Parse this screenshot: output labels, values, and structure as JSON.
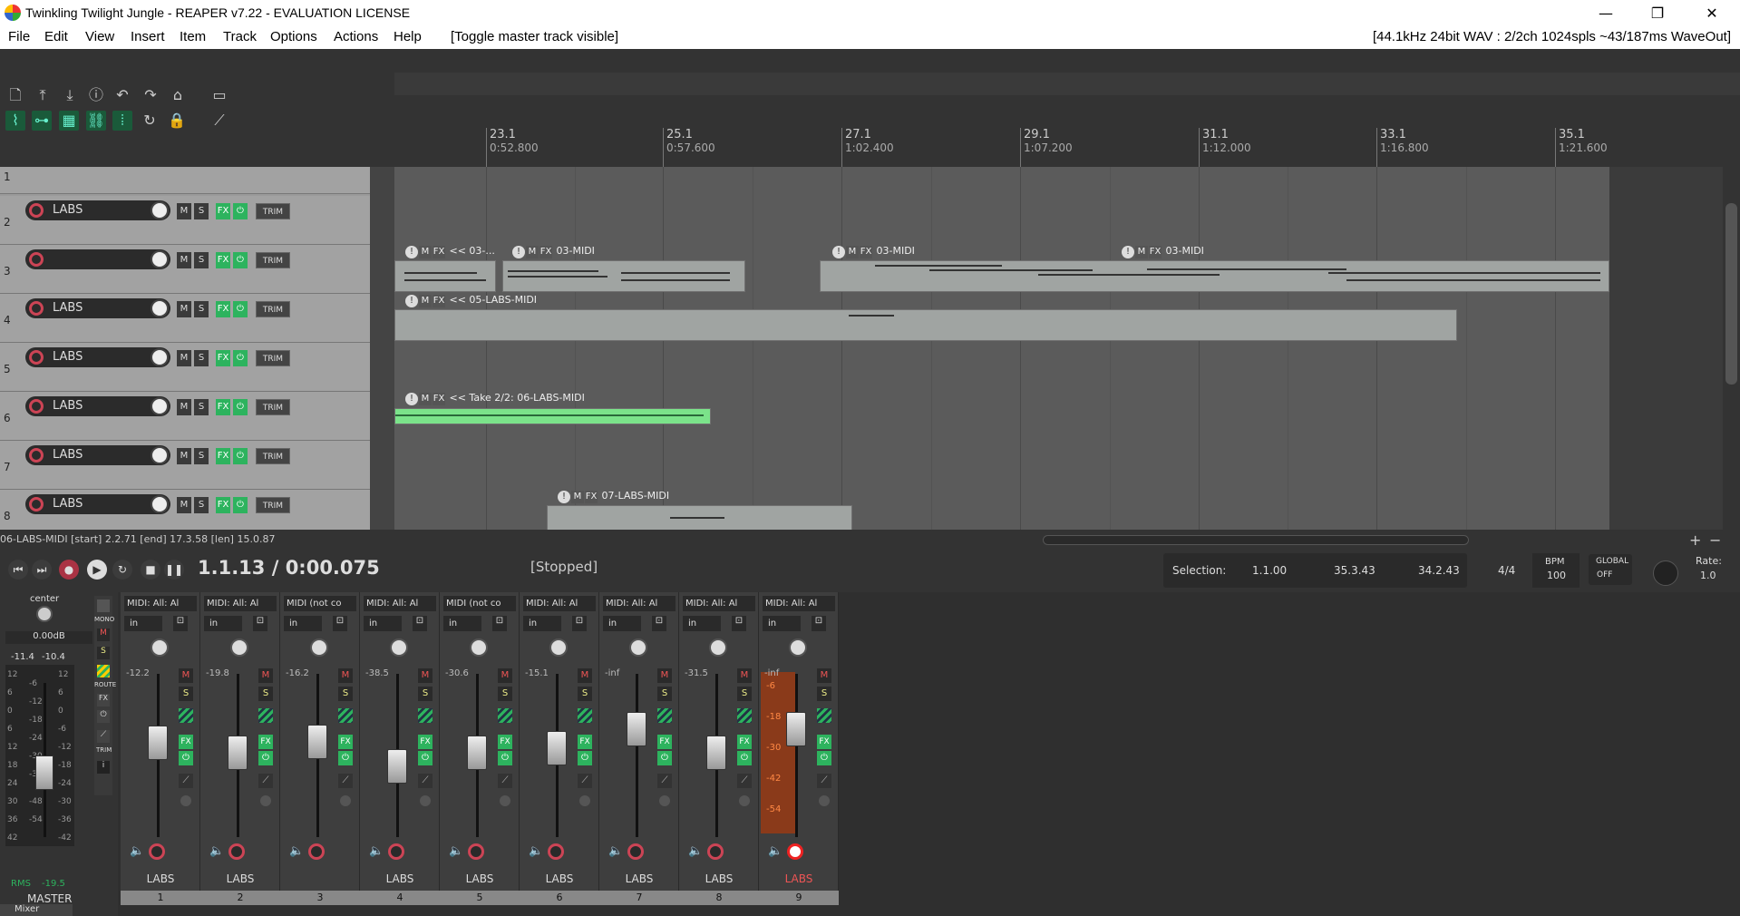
{
  "window": {
    "title": "Twinkling Twilight Jungle - REAPER v7.22 - EVALUATION LICENSE",
    "controls": [
      "—",
      "❐",
      "✕"
    ]
  },
  "menu": {
    "items": [
      "File",
      "Edit",
      "View",
      "Insert",
      "Item",
      "Track",
      "Options",
      "Actions",
      "Help",
      "[Toggle master track visible]"
    ],
    "status": "[44.1kHz 24bit WAV : 2/2ch 1024spls ~43/187ms WaveOut]"
  },
  "ruler": {
    "marks": [
      {
        "bar": "23.1",
        "time": "0:52.800"
      },
      {
        "bar": "25.1",
        "time": "0:57.600"
      },
      {
        "bar": "27.1",
        "time": "1:02.400"
      },
      {
        "bar": "29.1",
        "time": "1:07.200"
      },
      {
        "bar": "31.1",
        "time": "1:12.000"
      },
      {
        "bar": "33.1",
        "time": "1:16.800"
      },
      {
        "bar": "35.1",
        "time": "1:21.600"
      }
    ]
  },
  "tracks": [
    {
      "num": "1",
      "name": ""
    },
    {
      "num": "2",
      "name": "LABS"
    },
    {
      "num": "3",
      "name": ""
    },
    {
      "num": "4",
      "name": "LABS"
    },
    {
      "num": "5",
      "name": "LABS"
    },
    {
      "num": "6",
      "name": "LABS"
    },
    {
      "num": "7",
      "name": "LABS"
    },
    {
      "num": "8",
      "name": "LABS"
    }
  ],
  "track_buttons": {
    "mute": "M",
    "solo": "S",
    "fx": "FX",
    "trim": "TRIM"
  },
  "items": {
    "t3a": "<< 03-...",
    "t3b": "03-MIDI",
    "t3c": "03-MIDI",
    "t3d": "03-MIDI",
    "t4": "<< 05-LABS-MIDI",
    "t6": "<< Take 2/2: 06-LABS-MIDI",
    "t8": "07-LABS-MIDI"
  },
  "item_info": "06-LABS-MIDI [start] 2.2.71 [end] 17.3.58 [len] 15.0.87",
  "transport": {
    "time": "1.1.13 / 0:00.075",
    "state": "[Stopped]",
    "selection_label": "Selection:",
    "sel_start": "1.1.00",
    "sel_end": "35.3.43",
    "sel_len": "34.2.43",
    "timesig": "4/4",
    "bpm_label": "BPM",
    "bpm": "100",
    "global_label": "GLOBAL",
    "global_state": "OFF",
    "rate_label": "Rate:",
    "rate": "1.0"
  },
  "master": {
    "pan_label": "center",
    "vol": "0.00dB",
    "peak_l": "-11.4",
    "peak_r": "-10.4",
    "mono": "MONO",
    "route": "ROUTE",
    "trim": "TRIM",
    "rms_label": "RMS",
    "rms": "-19.5",
    "name": "MASTER",
    "scale_l": [
      "12",
      "6",
      "0",
      "6",
      "12",
      "18",
      "24",
      "30",
      "36",
      "42"
    ],
    "scale_m": [
      "-6",
      "-12",
      "-18",
      "-24",
      "-30",
      "-36",
      "-48",
      "-54"
    ],
    "scale_r": [
      "12",
      "6",
      "0",
      "-6",
      "-12",
      "-18",
      "-24",
      "-30",
      "-36",
      "-42"
    ]
  },
  "strips": [
    {
      "midi": "MIDI: All: Al",
      "in": "in",
      "vol": "-12.2",
      "name": "LABS",
      "num": "1",
      "fader": 0.62
    },
    {
      "midi": "MIDI: All: Al",
      "in": "in",
      "vol": "-19.8",
      "name": "LABS",
      "num": "2",
      "fader": 0.55
    },
    {
      "midi": "MIDI (not co",
      "in": "in",
      "vol": "-16.2",
      "name": "",
      "num": "3",
      "fader": 0.63
    },
    {
      "midi": "MIDI: All: Al",
      "in": "in",
      "vol": "-38.5",
      "name": "LABS",
      "num": "4",
      "fader": 0.45
    },
    {
      "midi": "MIDI (not co",
      "in": "in",
      "vol": "-30.6",
      "name": "LABS",
      "num": "5",
      "fader": 0.55
    },
    {
      "midi": "MIDI: All: Al",
      "in": "in",
      "vol": "-15.1",
      "name": "LABS",
      "num": "6",
      "fader": 0.58
    },
    {
      "midi": "MIDI: All: Al",
      "in": "in",
      "vol": "-inf",
      "name": "LABS",
      "num": "7",
      "fader": 0.72
    },
    {
      "midi": "MIDI: All: Al",
      "in": "in",
      "vol": "-31.5",
      "name": "LABS",
      "num": "8",
      "fader": 0.55
    },
    {
      "midi": "MIDI: All: Al",
      "in": "in",
      "vol": "-inf",
      "name": "LABS",
      "num": "9",
      "fader": 0.72
    }
  ],
  "strip9_meter": [
    "-6",
    "-18",
    "-30",
    "-42",
    "-54"
  ],
  "bottom_tab": "Mixer",
  "colors": {
    "green_accent": "#2db35e",
    "record_red": "#cc4455",
    "item_green": "#7be38a"
  }
}
